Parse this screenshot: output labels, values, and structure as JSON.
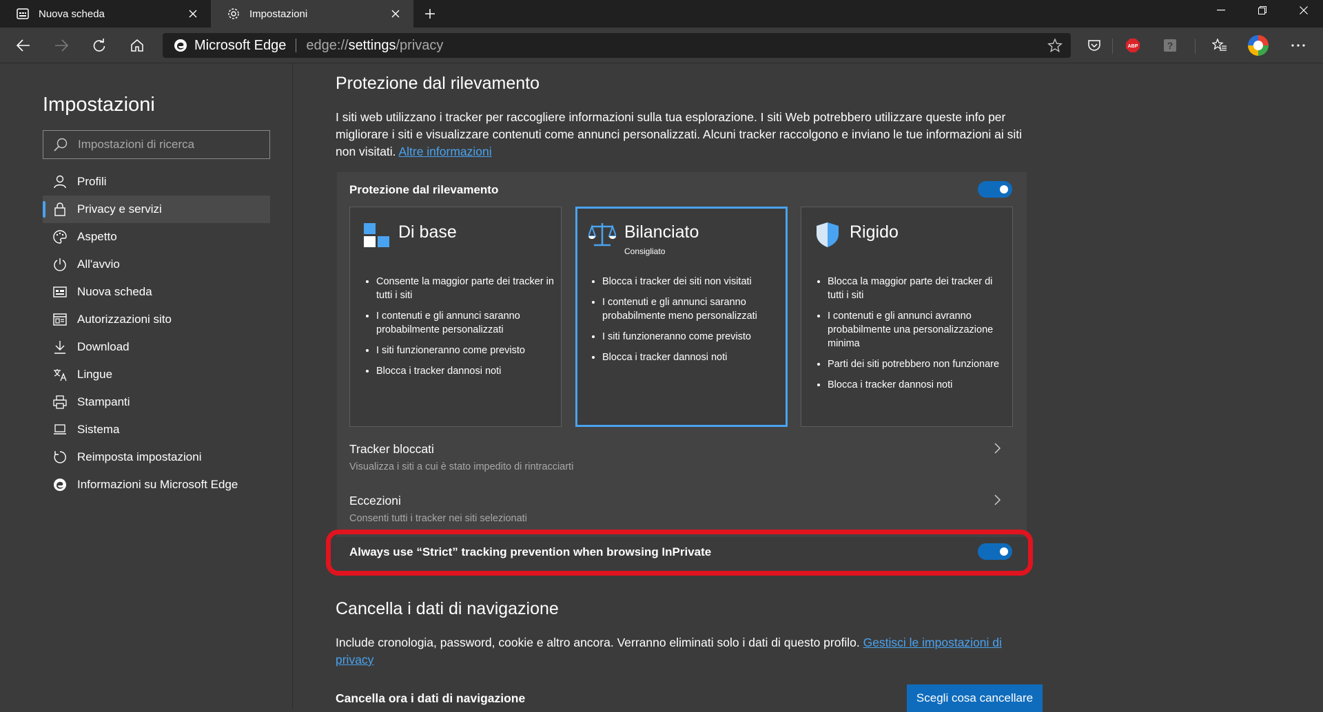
{
  "tabs": [
    {
      "label": "Nuova scheda",
      "icon": "newtab-icon"
    },
    {
      "label": "Impostazioni",
      "icon": "gear-icon"
    }
  ],
  "address": {
    "site": "Microsoft Edge",
    "url_prefix": "edge://",
    "url_main": "settings",
    "url_suffix": "/privacy"
  },
  "sidebar": {
    "title": "Impostazioni",
    "search_placeholder": "Impostazioni di ricerca",
    "items": [
      {
        "label": "Profili",
        "icon": "person-icon"
      },
      {
        "label": "Privacy e servizi",
        "icon": "lock-icon",
        "active": true
      },
      {
        "label": "Aspetto",
        "icon": "palette-icon"
      },
      {
        "label": "All'avvio",
        "icon": "power-icon"
      },
      {
        "label": "Nuova scheda",
        "icon": "newtab-icon"
      },
      {
        "label": "Autorizzazioni sito",
        "icon": "site-permissions-icon"
      },
      {
        "label": "Download",
        "icon": "download-icon"
      },
      {
        "label": "Lingue",
        "icon": "language-icon"
      },
      {
        "label": "Stampanti",
        "icon": "printer-icon"
      },
      {
        "label": "Sistema",
        "icon": "laptop-icon"
      },
      {
        "label": "Reimposta impostazioni",
        "icon": "reset-icon"
      },
      {
        "label": "Informazioni su Microsoft Edge",
        "icon": "edge-icon"
      }
    ]
  },
  "tracking": {
    "heading": "Protezione dal rilevamento",
    "description": "I siti web utilizzano i tracker per raccogliere informazioni sulla tua esplorazione. I siti Web potrebbero utilizzare queste info per migliorare i siti e visualizzare contenuti come annunci personalizzati. Alcuni tracker raccolgono e inviano le tue informazioni ai siti non visitati. ",
    "learn_more": "Altre informazioni",
    "card_title": "Protezione dal rilevamento",
    "toggle_on": true,
    "options": [
      {
        "name": "Di base",
        "subtitle": "",
        "icon": "basic-blocks-icon",
        "selected": false,
        "bullets": [
          "Consente la maggior parte dei tracker in tutti i siti",
          "I contenuti e gli annunci saranno probabilmente personalizzati",
          "I siti funzioneranno come previsto",
          "Blocca i tracker dannosi noti"
        ]
      },
      {
        "name": "Bilanciato",
        "subtitle": "Consigliato",
        "icon": "balance-scale-icon",
        "selected": true,
        "bullets": [
          "Blocca i tracker dei siti non visitati",
          "I contenuti e gli annunci saranno probabilmente meno personalizzati",
          "I siti funzioneranno come previsto",
          "Blocca i tracker dannosi noti"
        ]
      },
      {
        "name": "Rigido",
        "subtitle": "",
        "icon": "shield-icon",
        "selected": false,
        "bullets": [
          "Blocca la maggior parte dei tracker di tutti i siti",
          "I contenuti e gli annunci avranno probabilmente una personalizzazione minima",
          "Parti dei siti potrebbero non funzionare",
          "Blocca i tracker dannosi noti"
        ]
      }
    ],
    "blocked": {
      "title": "Tracker bloccati",
      "subtitle": "Visualizza i siti a cui è stato impedito di rintracciarti"
    },
    "exceptions": {
      "title": "Eccezioni",
      "subtitle": "Consenti tutti i tracker nei siti selezionati"
    },
    "inprivate": {
      "label": "Always use “Strict” tracking prevention when browsing InPrivate",
      "on": true
    }
  },
  "clear": {
    "heading": "Cancella i dati di navigazione",
    "description": "Include cronologia, password, cookie e altro ancora. Verranno eliminati solo i dati di questo profilo. ",
    "manage_link": "Gestisci le impostazioni di privacy",
    "now_label": "Cancella ora i dati di navigazione",
    "choose_button": "Scegli cosa cancellare"
  },
  "colors": {
    "accent": "#0f6cbd",
    "link": "#4aa3f0",
    "highlight": "#e0141e",
    "background": "#3b3b3b"
  }
}
